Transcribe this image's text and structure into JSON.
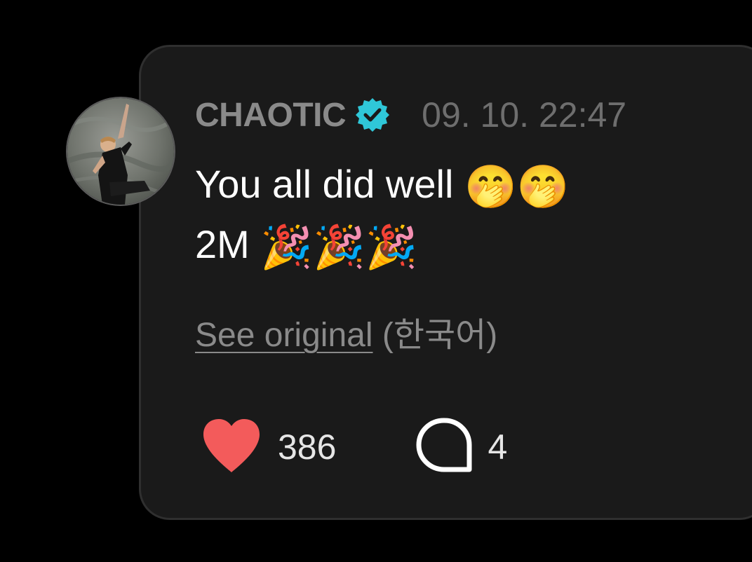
{
  "post": {
    "username": "CHAOTIC",
    "verified": true,
    "timestamp": "09. 10. 22:47",
    "text_line1": "You all did well",
    "text_line1_emoji": "🤭🤭",
    "text_line2": "2M",
    "text_line2_emoji": "🎉🎉🎉",
    "see_original_label": "See original",
    "original_language": "(한국어)"
  },
  "actions": {
    "likes_count": "386",
    "comments_count": "4"
  },
  "icons": {
    "verified": "verified-badge-icon",
    "like": "heart-icon",
    "comment": "speech-bubble-icon"
  },
  "colors": {
    "background": "#000000",
    "card": "#1a1a1a",
    "card_border": "#2f2f2f",
    "verified_badge": "#2fc7d8",
    "heart": "#f35b5b",
    "muted_text": "#8a8a8a",
    "primary_text": "#ffffff"
  }
}
